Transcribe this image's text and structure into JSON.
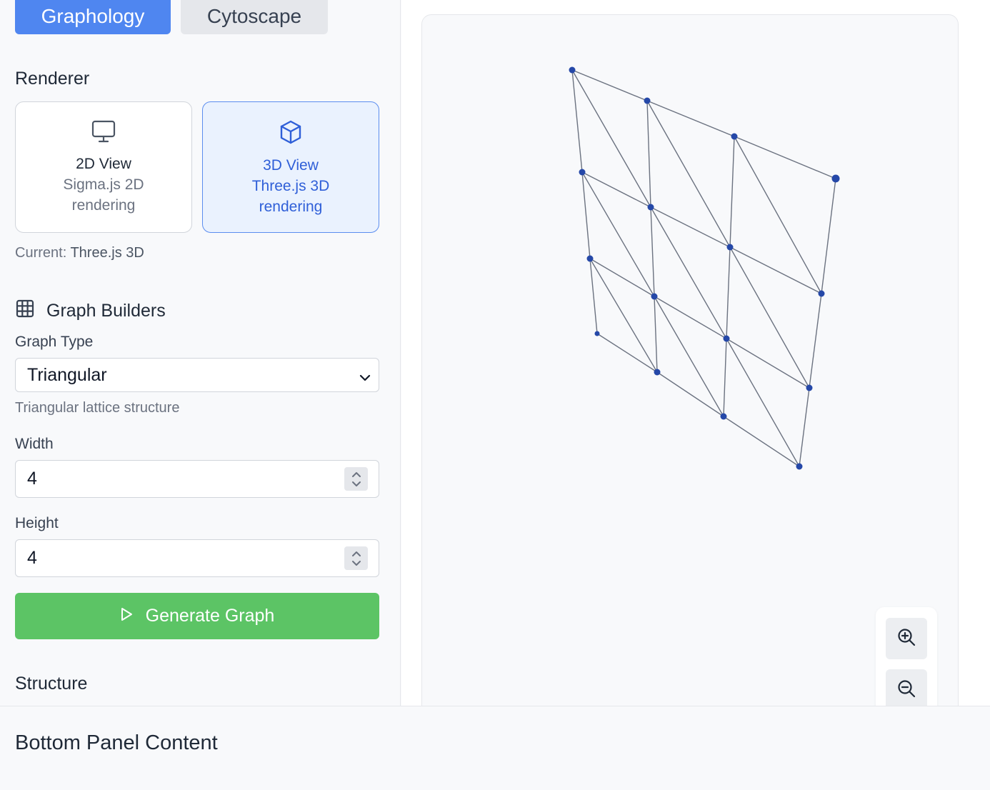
{
  "library_tabs": [
    {
      "label": "Graphology",
      "active": true
    },
    {
      "label": "Cytoscape",
      "active": false
    }
  ],
  "renderer": {
    "title": "Renderer",
    "options": [
      {
        "title": "2D View",
        "subtitle": "Sigma.js 2D rendering",
        "icon": "monitor-icon",
        "active": false
      },
      {
        "title": "3D View",
        "subtitle": "Three.js 3D rendering",
        "icon": "cube-icon",
        "active": true
      }
    ],
    "current_prefix": "Current:",
    "current_value": "Three.js 3D"
  },
  "graph_builders": {
    "title": "Graph Builders",
    "icon": "grid-icon",
    "graph_type_label": "Graph Type",
    "graph_type_value": "Triangular",
    "graph_type_description": "Triangular lattice structure",
    "width_label": "Width",
    "width_value": "4",
    "height_label": "Height",
    "height_value": "4",
    "generate_label": "Generate Graph"
  },
  "structure": {
    "title": "Structure"
  },
  "graph": {
    "type": "triangular-lattice",
    "width": 4,
    "height": 4,
    "node_color": "#2548a8",
    "edge_color": "#6b7280"
  },
  "zoom_controls": [
    "zoom-in-icon",
    "zoom-out-icon"
  ],
  "bottom_panel": {
    "title": "Bottom Panel Content"
  },
  "colors": {
    "primary": "#4f86f0",
    "success": "#5cc465",
    "active_card_bg": "#eaf2fe"
  }
}
